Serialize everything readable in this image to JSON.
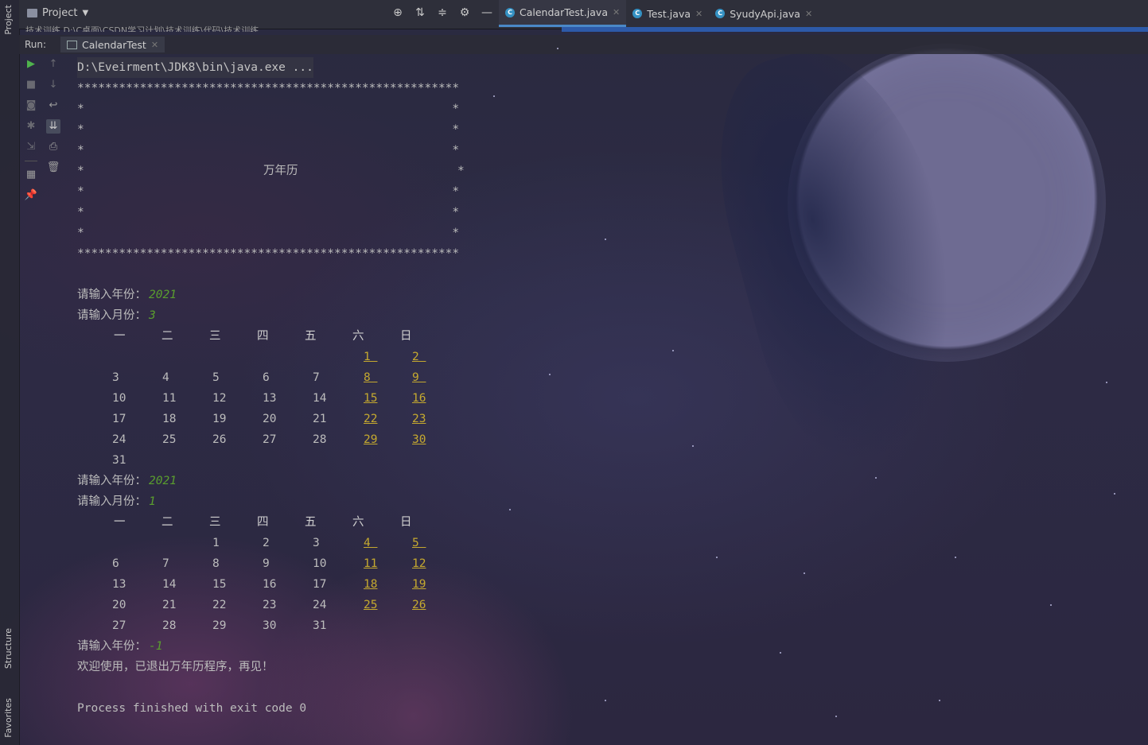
{
  "side_tabs": {
    "project": "Project",
    "structure": "Structure",
    "favorites": "Favorites"
  },
  "top_bar": {
    "project_label": "Project",
    "breadcrumb": "技术训练  D:\\C桌面\\CSDN学习计划\\技术训练\\代码\\技术训练",
    "tools": [
      "crosshair-icon",
      "expand-all-icon",
      "collapse-all-icon",
      "gear-icon",
      "minimize-icon"
    ],
    "tabs": [
      {
        "label": "CalendarTest.java",
        "active": true
      },
      {
        "label": "Test.java",
        "active": false
      },
      {
        "label": "SyudyApi.java",
        "active": false
      }
    ]
  },
  "run_panel": {
    "label": "Run:",
    "tab": "CalendarTest"
  },
  "console": {
    "command": "D:\\Eveirment\\JDK8\\bin\\java.exe ...",
    "border_line": "*******************************************************",
    "banner_title": "万年历",
    "prompt_year": "请输入年份：",
    "prompt_month": "请输入月份：",
    "weekdays": [
      "一",
      "二",
      "三",
      "四",
      "五",
      "六",
      "日"
    ],
    "sessions": [
      {
        "year": "2021",
        "month": "3",
        "weeks": [
          [
            "",
            "",
            "",
            "",
            "",
            "1",
            "2"
          ],
          [
            "3",
            "4",
            "5",
            "6",
            "7",
            "8",
            "9"
          ],
          [
            "10",
            "11",
            "12",
            "13",
            "14",
            "15",
            "16"
          ],
          [
            "17",
            "18",
            "19",
            "20",
            "21",
            "22",
            "23"
          ],
          [
            "24",
            "25",
            "26",
            "27",
            "28",
            "29",
            "30"
          ],
          [
            "31",
            "",
            "",
            "",
            "",
            "",
            ""
          ]
        ]
      },
      {
        "year": "2021",
        "month": "1",
        "weeks": [
          [
            "",
            "",
            "1",
            "2",
            "3",
            "4",
            "5"
          ],
          [
            "6",
            "7",
            "8",
            "9",
            "10",
            "11",
            "12"
          ],
          [
            "13",
            "14",
            "15",
            "16",
            "17",
            "18",
            "19"
          ],
          [
            "20",
            "21",
            "22",
            "23",
            "24",
            "25",
            "26"
          ],
          [
            "27",
            "28",
            "29",
            "30",
            "31",
            "",
            ""
          ]
        ]
      }
    ],
    "final_year_input": "-1",
    "goodbye": "欢迎使用，已退出万年历程序，再见！",
    "exit_message": "Process finished with exit code 0"
  },
  "colors": {
    "input_green": "#5a9e2e",
    "weekend_link": "#c5a92f",
    "tab_accent": "#4a88c7",
    "run_green": "#4fb34d"
  }
}
